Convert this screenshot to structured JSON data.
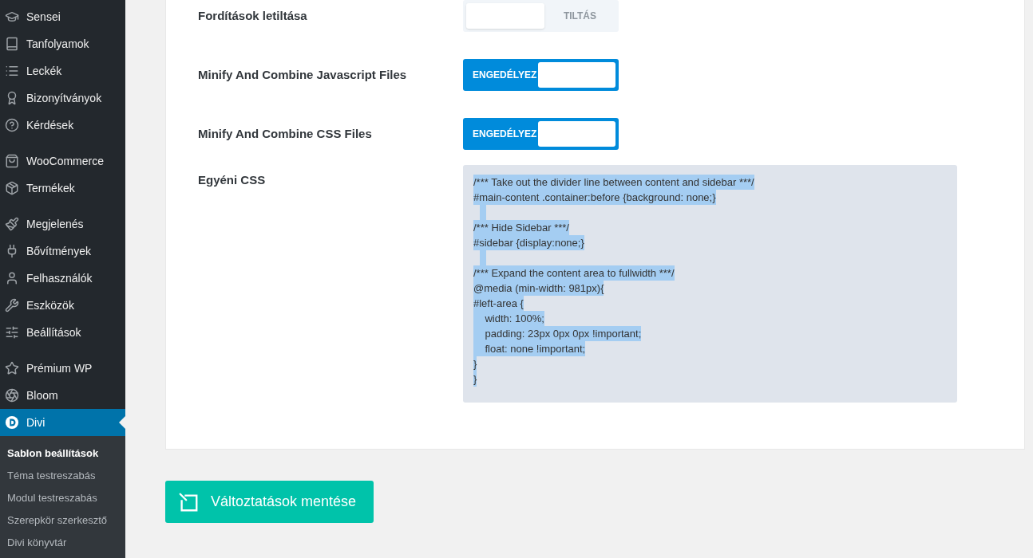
{
  "sidebar": {
    "groups": [
      {
        "items": [
          {
            "label": "Sensei",
            "selected": false
          },
          {
            "label": "Tanfolyamok",
            "selected": false
          },
          {
            "label": "Leckék",
            "selected": false
          },
          {
            "label": "Bizonyítványok",
            "selected": false
          },
          {
            "label": "Kérdések",
            "selected": false
          }
        ]
      },
      {
        "items": [
          {
            "label": "WooCommerce",
            "selected": false
          },
          {
            "label": "Termékek",
            "selected": false
          }
        ]
      },
      {
        "items": [
          {
            "label": "Megjelenés",
            "selected": false
          },
          {
            "label": "Bővítmények",
            "selected": false
          },
          {
            "label": "Felhasználók",
            "selected": false
          },
          {
            "label": "Eszközök",
            "selected": false
          },
          {
            "label": "Beállítások",
            "selected": false
          }
        ]
      },
      {
        "items": [
          {
            "label": "Prémium WP",
            "selected": false
          },
          {
            "label": "Bloom",
            "selected": false
          },
          {
            "label": "Divi",
            "selected": true
          }
        ]
      }
    ],
    "submenu": [
      {
        "label": "Sablon beállítások",
        "selected": true
      },
      {
        "label": "Téma testreszabás",
        "selected": false
      },
      {
        "label": "Modul testreszabás",
        "selected": false
      },
      {
        "label": "Szerepkör szerkesztő",
        "selected": false
      },
      {
        "label": "Divi könyvtár",
        "selected": false
      }
    ]
  },
  "settings": [
    {
      "kind": "toggle",
      "label": "Fordítások letiltása",
      "on": false,
      "state_text": "TILTÁS"
    },
    {
      "kind": "toggle",
      "label": "Minify And Combine Javascript Files",
      "on": true,
      "state_text": "ENGEDÉLYEZ"
    },
    {
      "kind": "toggle",
      "label": "Minify And Combine CSS Files",
      "on": true,
      "state_text": "ENGEDÉLYEZ"
    },
    {
      "kind": "code",
      "label": "Egyéni CSS",
      "value": "/*** Take out the divider line between content and sidebar ***/\n#main-content .container:before {background: none;}\n\n/*** Hide Sidebar ***/\n#sidebar {display:none;}\n\n/*** Expand the content area to fullwidth ***/\n@media (min-width: 981px){\n#left-area {\n    width: 100%;\n    padding: 23px 0px 0px !important;\n    float: none !important;\n}\n}"
    }
  ],
  "save_button": {
    "label": "Változtatások mentése"
  }
}
